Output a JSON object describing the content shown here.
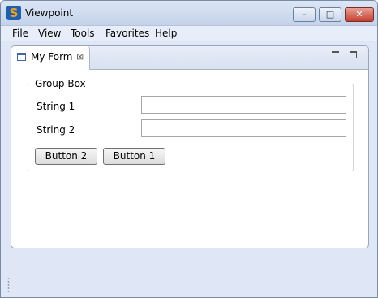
{
  "window": {
    "title": "Viewpoint",
    "app_icon_letter": "S"
  },
  "window_controls": {
    "minimize": "–",
    "maximize": "□",
    "close": "✕"
  },
  "menu": {
    "items": [
      "File",
      "View",
      "Tools",
      "Favorites",
      "Help"
    ]
  },
  "tab": {
    "label": "My Form",
    "close": "⊠"
  },
  "form": {
    "group_label": "Group Box",
    "fields": [
      {
        "label": "String 1",
        "value": ""
      },
      {
        "label": "String 2",
        "value": ""
      }
    ],
    "buttons": [
      "Button 2",
      "Button 1"
    ]
  },
  "colors": {
    "accent": "#1d5fb0",
    "close": "#c3402f",
    "frame": "#dfe6f5"
  }
}
